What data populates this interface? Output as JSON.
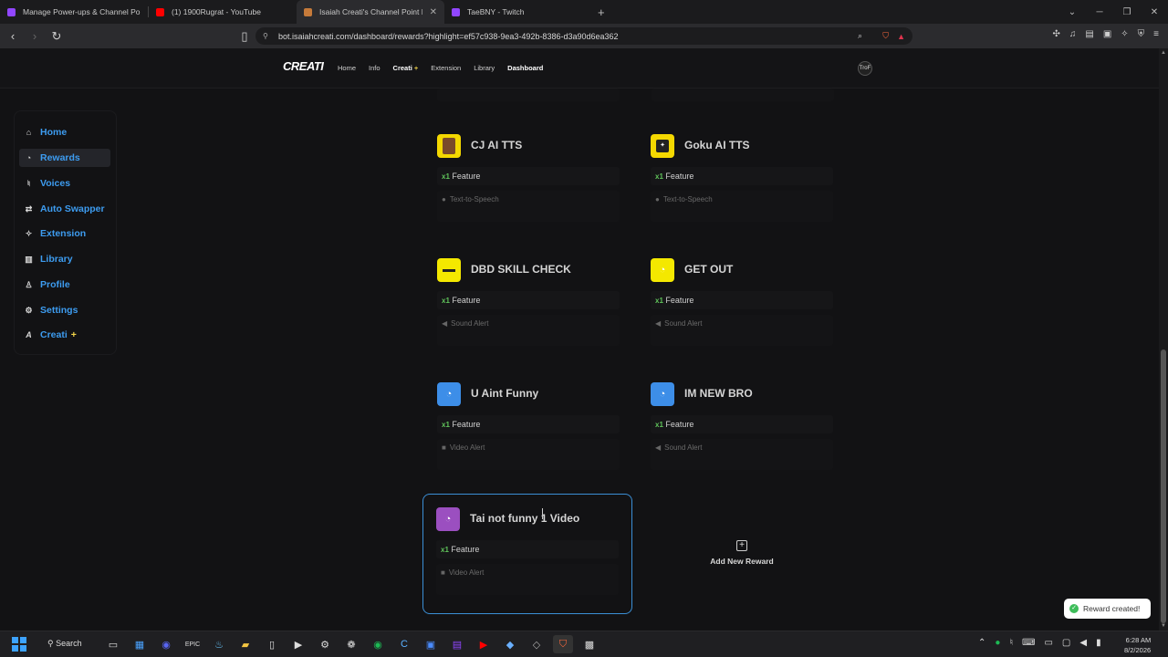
{
  "tabs": [
    {
      "title": "Manage Power-ups & Channel Points",
      "color": "#9146ff"
    },
    {
      "title": "(1) 1900Rugrat - YouTube",
      "color": "#ff0000"
    },
    {
      "title": "Isaiah Creati's Channel Point Bot",
      "color": "#c57a3a"
    },
    {
      "title": "TaeBNY - Twitch",
      "color": "#9146ff"
    }
  ],
  "address": {
    "url": "bot.isaiahcreati.com/dashboard/rewards?highlight=ef57c938-9ea3-492b-8386-d3a90d6ea362"
  },
  "site_nav": {
    "logo": "CREATI",
    "links": [
      "Home",
      "Info",
      "Creati",
      "Extension",
      "Library",
      "Dashboard"
    ],
    "creati_plus": "+",
    "avatar_text": "TroF"
  },
  "sidebar": {
    "items": [
      {
        "label": "Home",
        "icon": "home-icon",
        "glyph": "⌂"
      },
      {
        "label": "Rewards",
        "icon": "reward-icon",
        "glyph": "◔"
      },
      {
        "label": "Voices",
        "icon": "microphone-icon",
        "glyph": "♮"
      },
      {
        "label": "Auto Swapper",
        "icon": "swap-icon",
        "glyph": "⇄"
      },
      {
        "label": "Extension",
        "icon": "puzzle-icon",
        "glyph": "✧"
      },
      {
        "label": "Library",
        "icon": "library-icon",
        "glyph": "▥"
      },
      {
        "label": "Profile",
        "icon": "user-icon",
        "glyph": "♙"
      },
      {
        "label": "Settings",
        "icon": "gear-icon",
        "glyph": "⚙"
      },
      {
        "label": "Creati",
        "icon": "creati-logo-icon",
        "glyph": "A"
      }
    ],
    "active_index": 1,
    "creati_plus": "+"
  },
  "rewards": [
    {
      "title": "CJ AI TTS",
      "feature_count": "x1",
      "feature_label": "Feature",
      "action": "Text-to-Speech",
      "icon_bg": "#f4d800",
      "icon": "cj-avatar-icon"
    },
    {
      "title": "Goku AI TTS",
      "feature_count": "x1",
      "feature_label": "Feature",
      "action": "Text-to-Speech",
      "icon_bg": "#f4d800",
      "icon": "goku-avatar-icon"
    },
    {
      "title": "DBD SKILL CHECK",
      "feature_count": "x1",
      "feature_label": "Feature",
      "action": "Sound Alert",
      "icon_bg": "#f4e800",
      "icon": "dbd-icon"
    },
    {
      "title": "GET OUT",
      "feature_count": "x1",
      "feature_label": "Feature",
      "action": "Sound Alert",
      "icon_bg": "#f4e800",
      "icon": "reward-icon"
    },
    {
      "title": "U Aint Funny",
      "feature_count": "x1",
      "feature_label": "Feature",
      "action": "Video Alert",
      "icon_bg": "#3d8ee8",
      "icon": "reward-icon"
    },
    {
      "title": "IM NEW BRO",
      "feature_count": "x1",
      "feature_label": "Feature",
      "action": "Sound Alert",
      "icon_bg": "#3d8ee8",
      "icon": "reward-icon"
    },
    {
      "title": "Tai not funny 1 Video",
      "feature_count": "x1",
      "feature_label": "Feature",
      "action": "Video Alert",
      "icon_bg": "#9b4fc0",
      "icon": "reward-icon"
    }
  ],
  "add_new": {
    "label": "Add New Reward"
  },
  "toast": {
    "message": "Reward created!"
  },
  "taskbar": {
    "search": "Search",
    "time": "6:28 AM",
    "date": "8/2/2026"
  }
}
